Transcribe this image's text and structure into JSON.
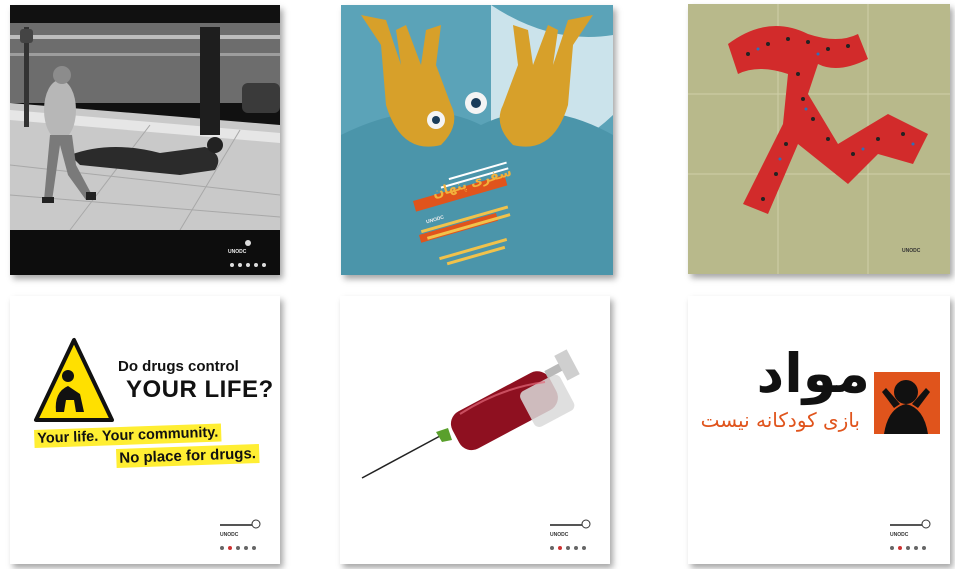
{
  "posters": [
    {
      "id_label": "poster-street",
      "badge": "UNODC"
    },
    {
      "id_label": "poster-hands",
      "badge": "UNODC",
      "persian_title": "سفری پنهان"
    },
    {
      "id_label": "poster-crowd",
      "badge": "UNODC"
    },
    {
      "id_label": "poster-drugs-control",
      "badge": "UNODC",
      "question_line1": "Do drugs control",
      "question_line2": "YOUR LIFE?",
      "slogan_line1": "Your life. Your community.",
      "slogan_line2": "No place for drugs."
    },
    {
      "id_label": "poster-syringe",
      "badge": "UNODC"
    },
    {
      "id_label": "poster-persian",
      "badge": "UNODC",
      "persian_big": "مواد",
      "persian_small": "بازی کودکانه نیست"
    }
  ],
  "colors": {
    "warning_yellow": "#ffe000",
    "highlight_yellow": "#ffee33",
    "orange": "#e0541c",
    "teal": "#5ba3b8"
  }
}
